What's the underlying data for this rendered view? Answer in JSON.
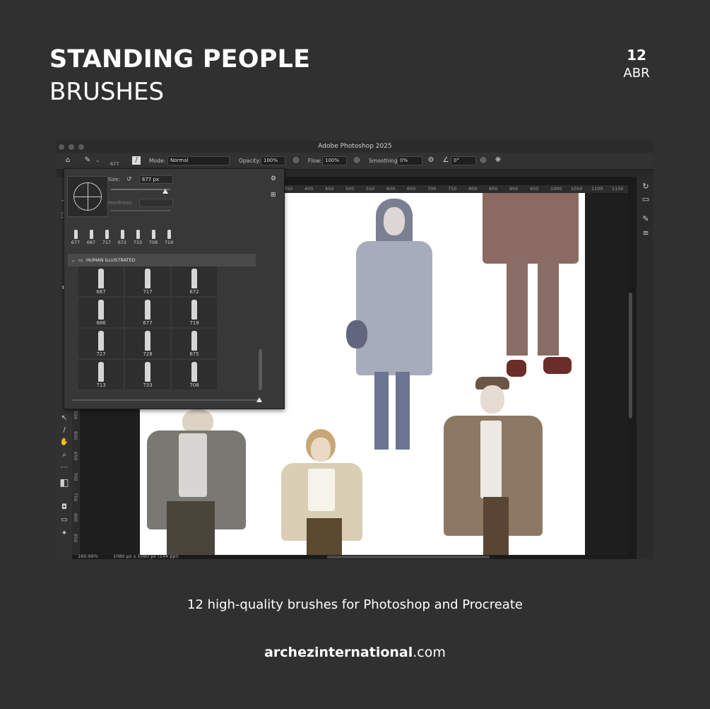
{
  "header": {
    "title_bold": "STANDING PEOPLE",
    "title_light": "BRUSHES",
    "count": "12",
    "format": "ABR"
  },
  "footer": {
    "tagline": "12 high-quality brushes for Photoshop and Procreate",
    "website_bold": "archezinternational",
    "website_suffix": ".com"
  },
  "photoshop": {
    "window_title": "Adobe Photoshop 2025",
    "options_bar": {
      "brush_size_preview": "677",
      "mode_label": "Mode:",
      "mode_value": "Normal",
      "opacity_label": "Opacity:",
      "opacity_value": "100%",
      "flow_label": "Flow:",
      "flow_value": "100%",
      "smoothing_label": "Smoothing:",
      "smoothing_value": "0%",
      "angle_value": "0°"
    },
    "ruler_ticks": [
      "350",
      "400",
      "450",
      "500",
      "550",
      "600",
      "650",
      "700",
      "750",
      "800",
      "850",
      "900",
      "950",
      "1000",
      "1050",
      "1100",
      "1150"
    ],
    "ruler_left_ticks": [
      "550",
      "600",
      "650",
      "700",
      "750",
      "800",
      "850"
    ],
    "status_bar": {
      "zoom": "160.99%",
      "doc_info": "1080 px x 1080 px (144 ppi)"
    },
    "brush_panel": {
      "size_label": "Size:",
      "size_value": "677 px",
      "hardness_label": "Hardness:",
      "recent_brushes": [
        "677",
        "687",
        "717",
        "672",
        "733",
        "708",
        "719"
      ],
      "folder_name": "HUMAN ILLUSTRATED",
      "brushes": [
        "687",
        "717",
        "672",
        "686",
        "677",
        "719",
        "727",
        "728",
        "675",
        "713",
        "733",
        "708"
      ]
    }
  },
  "colors": {
    "background": "#303030",
    "panel": "#383838",
    "canvas": "#ffffff"
  }
}
